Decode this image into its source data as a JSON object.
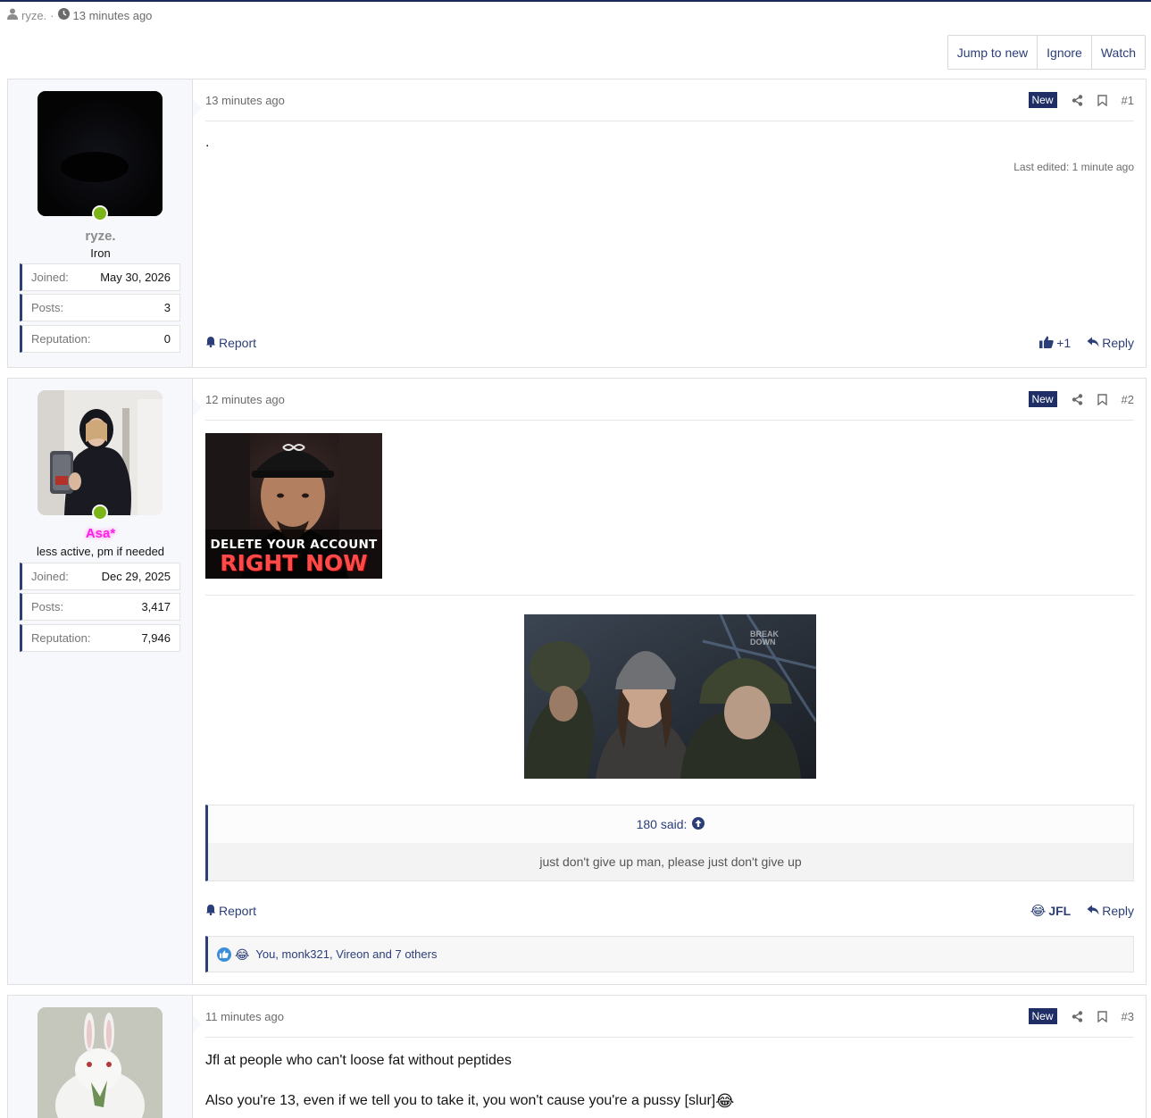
{
  "thread_meta": {
    "author": "ryze.",
    "separator": "·",
    "time": "13 minutes ago"
  },
  "thread_actions": {
    "jump_to_new": "Jump to new",
    "ignore": "Ignore",
    "watch": "Watch"
  },
  "labels": {
    "new": "New",
    "report": "Report",
    "reply": "Reply",
    "joined": "Joined:",
    "posts": "Posts:",
    "reputation": "Reputation:"
  },
  "posts": [
    {
      "number": "#1",
      "time": "13 minutes ago",
      "body": ".",
      "last_edited": "Last edited: 1 minute ago",
      "user": {
        "name": "ryze.",
        "name_color": "#8c8c8c",
        "title": "Iron",
        "joined": "May 30, 2026",
        "posts": "3",
        "reputation": "0"
      },
      "reaction_action": "+1"
    },
    {
      "number": "#2",
      "time": "12 minutes ago",
      "user": {
        "name": "Asa*",
        "name_color": "#ff1fe6",
        "title": "less active, pm if needed",
        "joined": "Dec 29, 2025",
        "posts": "3,417",
        "reputation": "7,946"
      },
      "image1_text": {
        "line1": "DELETE YOUR ACCOUNT",
        "line2": "RIGHT NOW"
      },
      "image2_watermark": "BREAK DOWN",
      "quote": {
        "author": "180 said:",
        "text": "just don't give up man, please just don't give up"
      },
      "reaction_action": "JFL",
      "reactions_summary": "You, monk321, Vireon and 7 others"
    },
    {
      "number": "#3",
      "time": "11 minutes ago",
      "body_line1": "Jfl at people who can't loose fat without peptides",
      "body_line2": "Also you're 13, even if we tell you to take it, you won't cause you're a pussy [slur]"
    }
  ],
  "colors": {
    "accent": "#2b3e78",
    "new_badge": "#1f2f66",
    "online": "#7cb518"
  }
}
